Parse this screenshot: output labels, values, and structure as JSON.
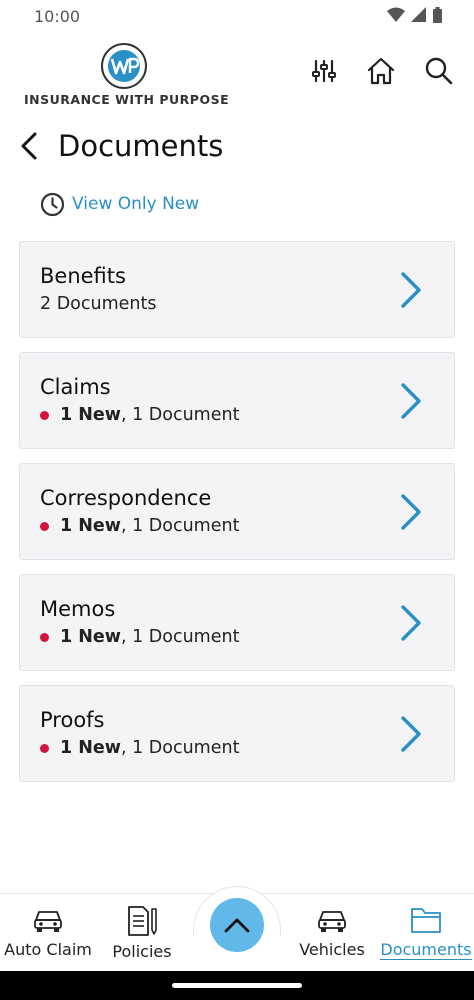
{
  "status_bar": {
    "time": "10:00"
  },
  "header": {
    "logo_text": "INSURANCE WITH PURPOSE",
    "icons": [
      "filter-sliders-icon",
      "home-icon",
      "search-icon"
    ]
  },
  "page": {
    "title": "Documents",
    "view_only_new": "View Only New"
  },
  "documents": [
    {
      "title": "Benefits",
      "new_count": "",
      "count_text": "2 Documents"
    },
    {
      "title": "Claims",
      "new_count": "1 New",
      "count_text": ", 1 Document"
    },
    {
      "title": "Correspondence",
      "new_count": "1 New",
      "count_text": ", 1 Document"
    },
    {
      "title": "Memos",
      "new_count": "1 New",
      "count_text": ", 1 Document"
    },
    {
      "title": "Proofs",
      "new_count": "1 New",
      "count_text": ", 1 Document"
    }
  ],
  "bottom_nav": {
    "items": [
      {
        "label": "Auto Claim"
      },
      {
        "label": "Policies"
      },
      {
        "label": "Vehicles"
      },
      {
        "label": "Documents"
      }
    ],
    "active": "Documents"
  },
  "colors": {
    "accent": "#2a8fc7",
    "fab": "#62b9e9",
    "new_dot": "#d0143c",
    "card_bg": "#f4f3f6"
  }
}
